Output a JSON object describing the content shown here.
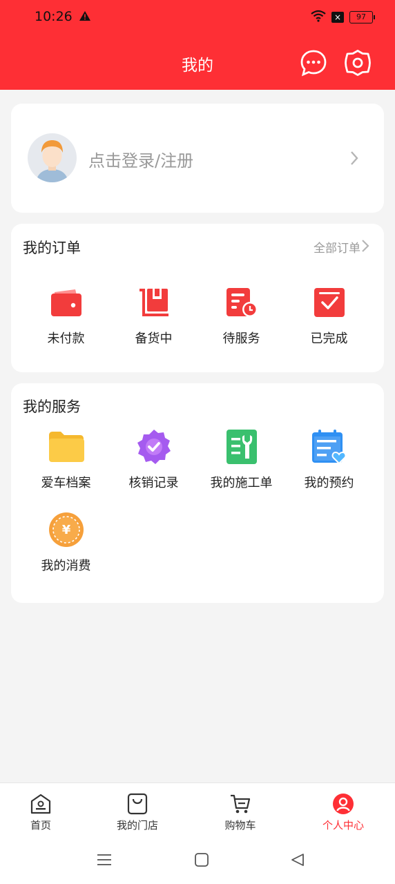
{
  "status": {
    "time": "10:26",
    "battery": "97",
    "icons": [
      "warning-icon",
      "wifi-icon",
      "sim-off-icon",
      "battery-icon"
    ]
  },
  "header": {
    "title": "我的",
    "icons": [
      "message-icon",
      "settings-icon"
    ]
  },
  "login": {
    "text": "点击登录/注册"
  },
  "orders": {
    "title": "我的订单",
    "all_label": "全部订单",
    "items": [
      {
        "label": "未付款",
        "icon": "wallet-icon"
      },
      {
        "label": "备货中",
        "icon": "stock-icon"
      },
      {
        "label": "待服务",
        "icon": "clock-doc-icon"
      },
      {
        "label": "已完成",
        "icon": "check-square-icon"
      }
    ]
  },
  "services": {
    "title": "我的服务",
    "items": [
      {
        "label": "爱车档案",
        "icon": "folder-icon"
      },
      {
        "label": "核销记录",
        "icon": "verify-badge-icon"
      },
      {
        "label": "我的施工单",
        "icon": "work-order-icon"
      },
      {
        "label": "我的预约",
        "icon": "calendar-heart-icon"
      },
      {
        "label": "我的消费",
        "icon": "yuan-coin-icon"
      }
    ]
  },
  "nav": [
    {
      "label": "首页",
      "icon": "home-icon"
    },
    {
      "label": "我的门店",
      "icon": "store-bag-icon"
    },
    {
      "label": "购物车",
      "icon": "cart-icon"
    },
    {
      "label": "个人中心",
      "icon": "profile-icon"
    }
  ],
  "colors": {
    "brand": "#fe2f35",
    "background": "#f4f4f4"
  }
}
